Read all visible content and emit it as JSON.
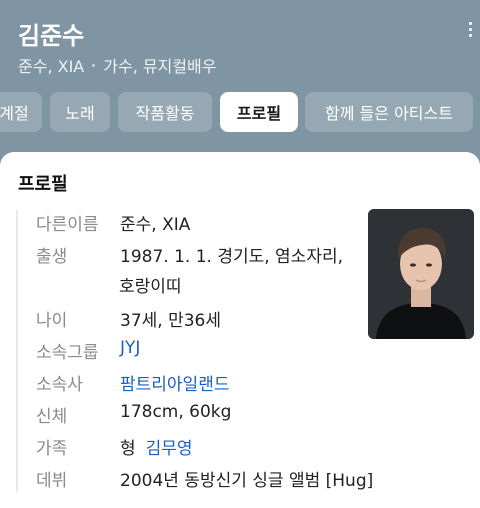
{
  "header": {
    "name": "김준수",
    "aliases": "준수, XIA",
    "occupation": "가수, 뮤지컬배우"
  },
  "tabs": [
    {
      "label": "계절"
    },
    {
      "label": "노래"
    },
    {
      "label": "작품활동"
    },
    {
      "label": "프로필",
      "active": true
    },
    {
      "label": "함께 들은 아티스트"
    }
  ],
  "profile": {
    "title": "프로필",
    "rows": {
      "other_names": {
        "label": "다른이름",
        "value": "준수, XIA"
      },
      "birth": {
        "label": "출생",
        "value_line1": "1987. 1. 1. 경기도, 염소자리,",
        "value_line2": "호랑이띠"
      },
      "age": {
        "label": "나이",
        "value": "37세, 만36세"
      },
      "group": {
        "label": "소속그룹",
        "value": "JYJ"
      },
      "agency": {
        "label": "소속사",
        "value": "팜트리아일랜드"
      },
      "body": {
        "label": "신체",
        "value": "178cm, 60kg"
      },
      "family": {
        "label": "가족",
        "relation": "형",
        "value": "김무영"
      },
      "debut": {
        "label": "데뷔",
        "value": "2004년 동방신기 싱글 앨범 [Hug]"
      }
    }
  },
  "colors": {
    "header_bg": "#7f95a3",
    "link": "#1a5fc2",
    "label_gray": "#8a8a8a"
  }
}
